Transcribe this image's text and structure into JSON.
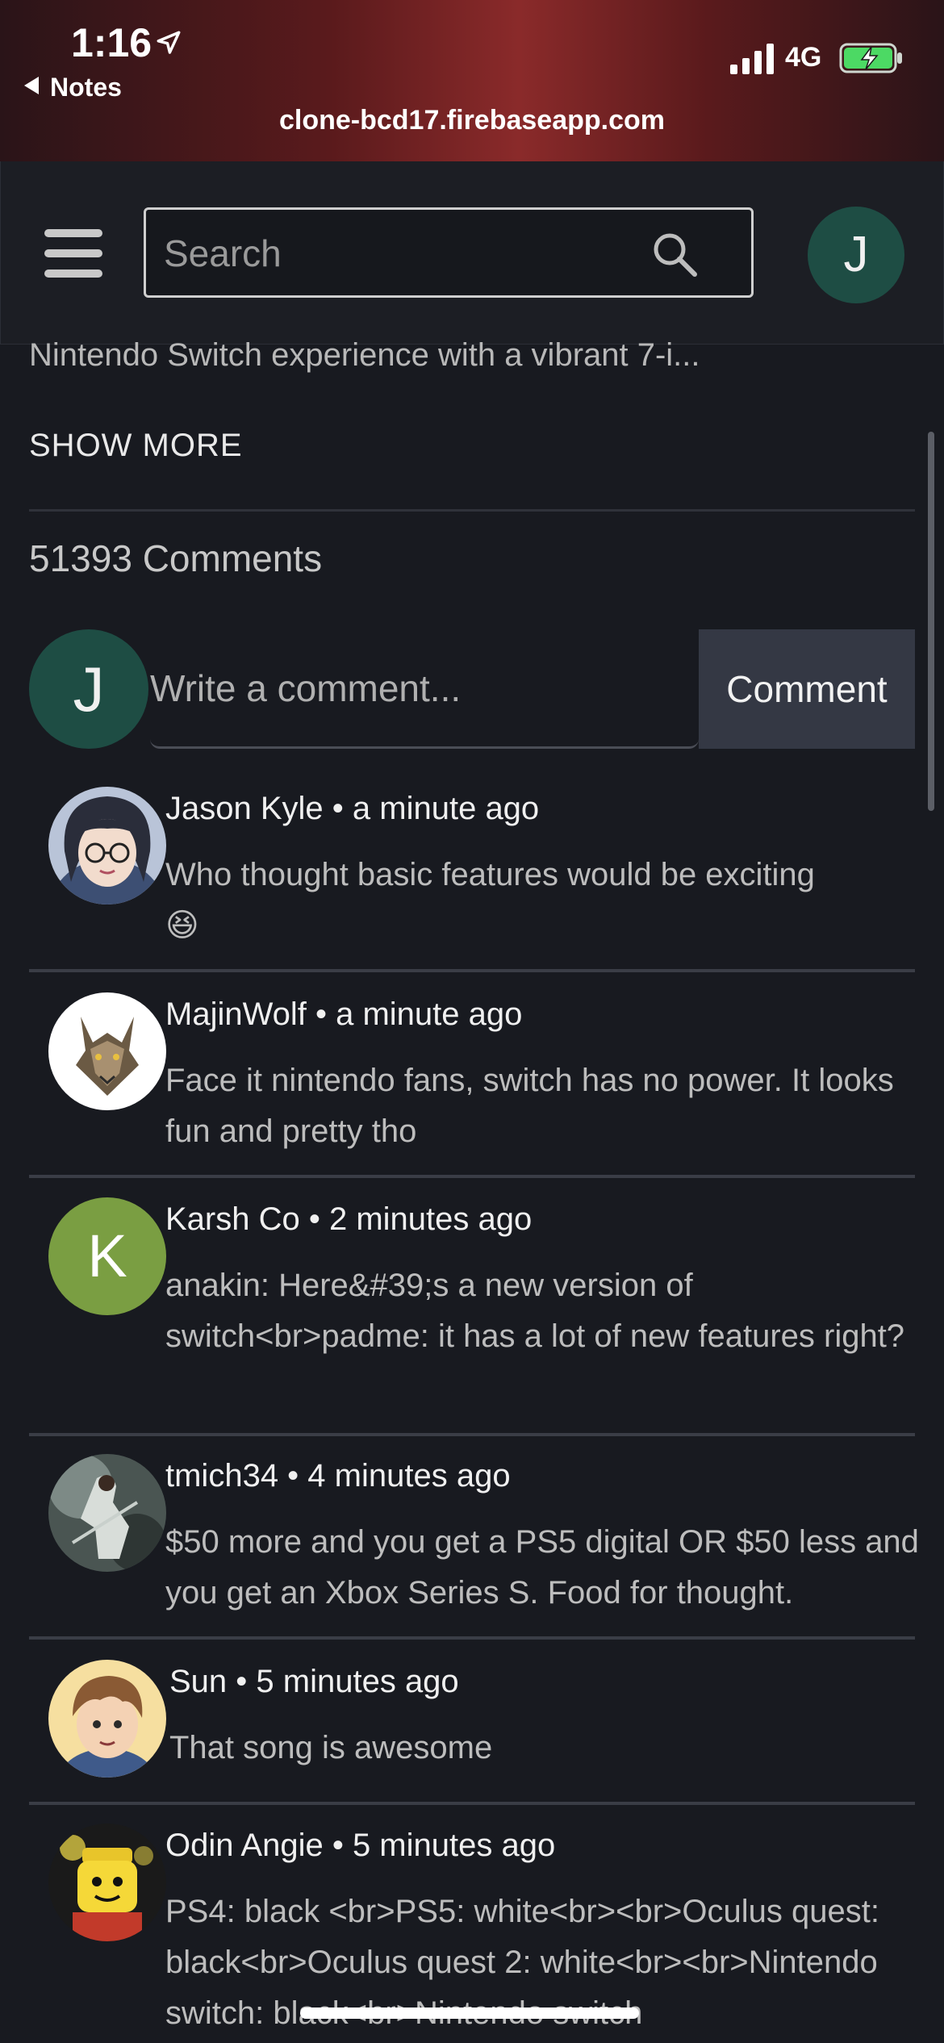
{
  "status_bar": {
    "time": "1:16",
    "back_label": "Notes",
    "network": "4G",
    "url": "clone-bcd17.firebaseapp.com"
  },
  "header": {
    "search_placeholder": "Search",
    "avatar_initial": "J"
  },
  "video": {
    "description_snippet": "Nintendo Switch experience with a vibrant 7-i...",
    "show_more_label": "SHOW MORE"
  },
  "comments_section": {
    "count_label": "51393 Comments",
    "composer_avatar_initial": "J",
    "composer_placeholder": "Write a comment...",
    "comment_button_label": "Comment"
  },
  "comments": [
    {
      "author": "Jason Kyle",
      "time": "a minute ago",
      "text": "Who thought basic features would be exciting",
      "emoji": "😆"
    },
    {
      "author": "MajinWolf",
      "time": "a minute ago",
      "text": "Face it nintendo fans, switch has no power. It looks fun and pretty tho"
    },
    {
      "author": "Karsh Co",
      "time": "2 minutes ago",
      "text": "anakin: Here&#39;s a new version of switch<br>padme: it has a lot of new features right?",
      "avatar_initial": "K"
    },
    {
      "author": "tmich34",
      "time": "4 minutes ago",
      "text": "$50 more and you get a PS5 digital OR $50 less and you get an Xbox Series S. Food for thought."
    },
    {
      "author": "Sun",
      "time": "5 minutes ago",
      "text": "That song is awesome"
    },
    {
      "author": "Odin Angie",
      "time": "5 minutes ago",
      "text": "PS4: black <br>PS5: white<br><br>Oculus quest: black<br>Oculus quest 2: white<br><br>Nintendo switch: black<br>Nintendo switch"
    }
  ],
  "colors": {
    "background": "#181a20",
    "avatar_teal": "#1e4d44",
    "avatar_green": "#7a9e42",
    "comment_button": "#343844"
  }
}
